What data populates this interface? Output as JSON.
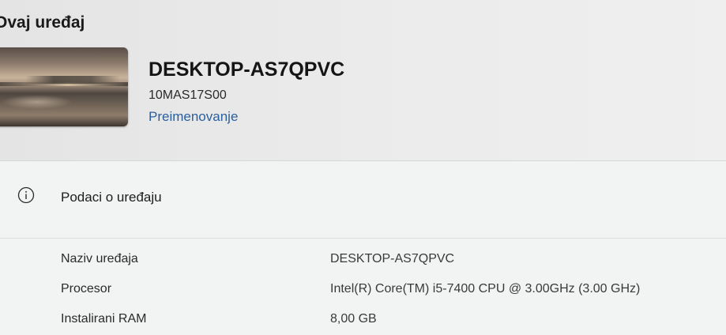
{
  "section": {
    "title": "Ovaj uređaj"
  },
  "device": {
    "name": "DESKTOP-AS7QPVC",
    "model": "10MAS17S00",
    "rename_label": "Preimenovanje",
    "wallpaper_icon": "desktop-wallpaper-thumbnail"
  },
  "specs": {
    "icon": "info-icon",
    "title": "Podaci o uređaju",
    "rows": [
      {
        "label": "Naziv uređaja",
        "value": "DESKTOP-AS7QPVC"
      },
      {
        "label": "Procesor",
        "value": "Intel(R) Core(TM) i5-7400 CPU @ 3.00GHz (3.00 GHz)"
      },
      {
        "label": "Instalirani RAM",
        "value": "8,00 GB"
      }
    ]
  },
  "colors": {
    "link": "#2a5f9e",
    "panel_background": "#f2f3f3",
    "page_background": "#e9e9e9"
  }
}
